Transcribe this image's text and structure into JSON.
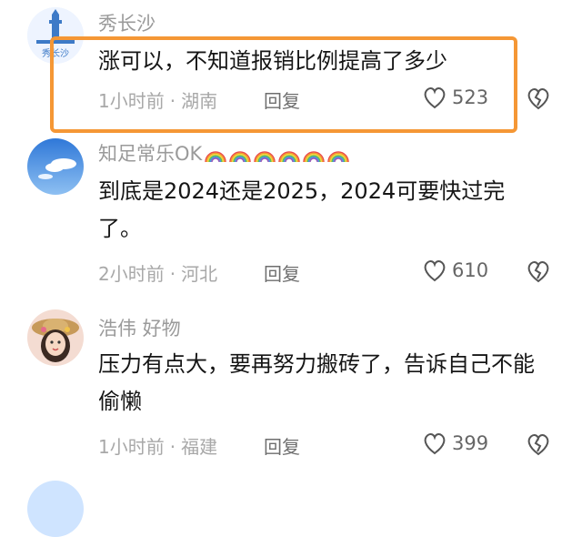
{
  "comments": [
    {
      "username": "秀长沙",
      "avatar_label": "秀长沙",
      "text": "涨可以，不知道报销比例提高了多少",
      "time": "1小时前",
      "location": "湖南",
      "reply": "回复",
      "likes": "523",
      "highlighted": true
    },
    {
      "username": "知足常乐OK",
      "rainbow_emoji_count": 6,
      "text": "到底是2024还是2025，2024可要快过完了。",
      "time": "2小时前",
      "location": "河北",
      "reply": "回复",
      "likes": "610"
    },
    {
      "username": "浩伟 好物",
      "text": "压力有点大，要再努力搬砖了，告诉自己不能偷懒",
      "time": "1小时前",
      "location": "福建",
      "reply": "回复",
      "likes": "399"
    }
  ],
  "icons": {
    "like": "heart-outline-icon",
    "dislike": "broken-heart-icon"
  },
  "colors": {
    "highlight_border": "#f59735",
    "username": "#9a9a9a",
    "text": "#161616",
    "meta": "#a8a8a8"
  }
}
